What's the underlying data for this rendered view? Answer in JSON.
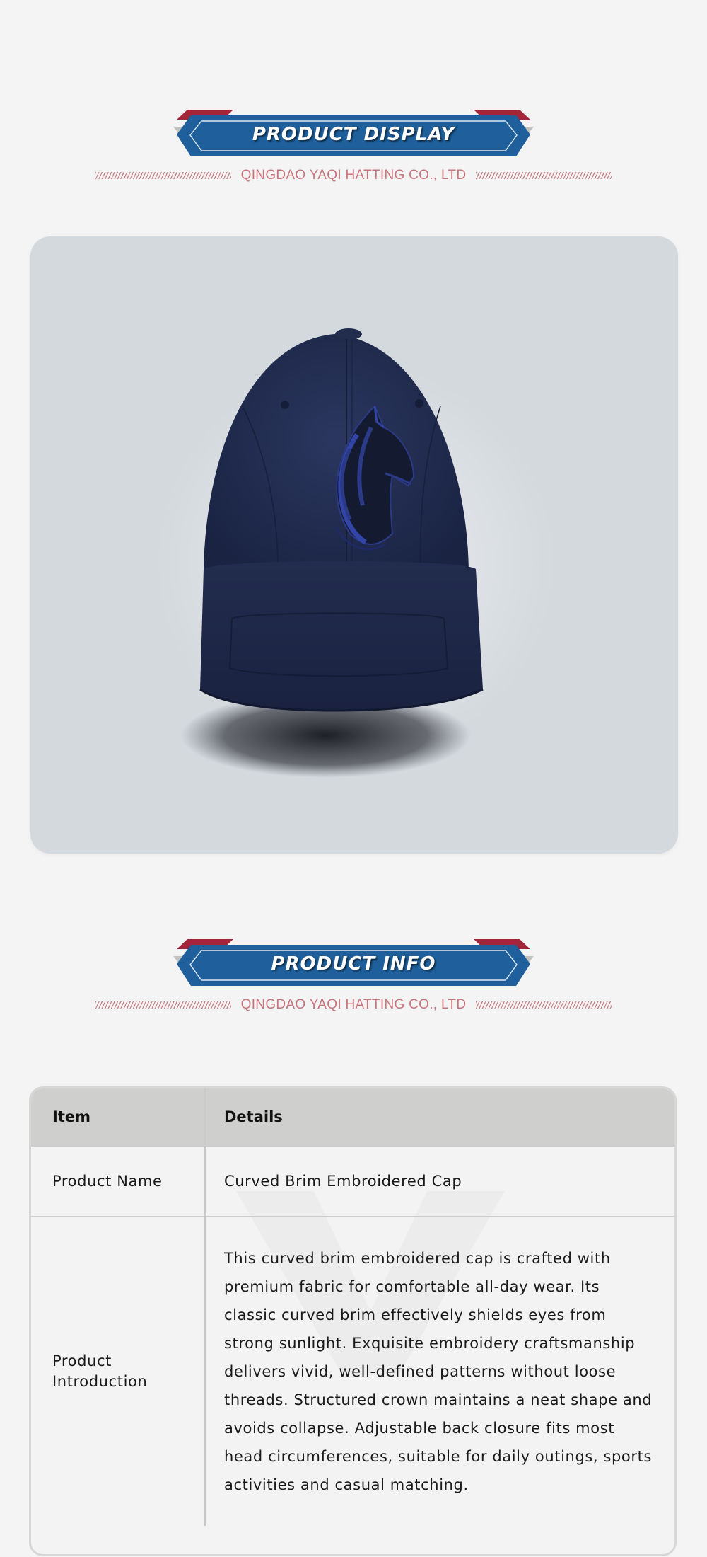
{
  "sections": {
    "display": {
      "title": "PRODUCT DISPLAY",
      "company": "QINGDAO YAQI HATTING CO., LTD"
    },
    "info": {
      "title": "PRODUCT INFO",
      "company": "QINGDAO YAQI HATTING CO., LTD"
    }
  },
  "product_image": {
    "icon": "embroidered-horse-cap-image",
    "cap_color": "#1f2a4a",
    "emblem_color": "#2b3a86"
  },
  "table": {
    "headers": {
      "item": "Item",
      "details": "Details"
    },
    "rows": [
      {
        "item": "Product Name",
        "details": "Curved Brim Embroidered Cap"
      },
      {
        "item": "Product Introduction",
        "details": "This curved brim embroidered cap is crafted with premium fabric for comfortable all-day wear. Its classic curved brim effectively shields eyes from strong sunlight. Exquisite embroidery craftsmanship delivers vivid, well-defined patterns without loose threads. Structured crown maintains a neat shape and avoids collapse. Adjustable back closure fits most head circumferences, suitable for daily outings, sports activities and casual matching."
      }
    ]
  },
  "colors": {
    "banner_blue": "#1f5f9b",
    "banner_red": "#a3253a",
    "company_text": "#c9737c",
    "header_bg": "#cfcfcd"
  }
}
